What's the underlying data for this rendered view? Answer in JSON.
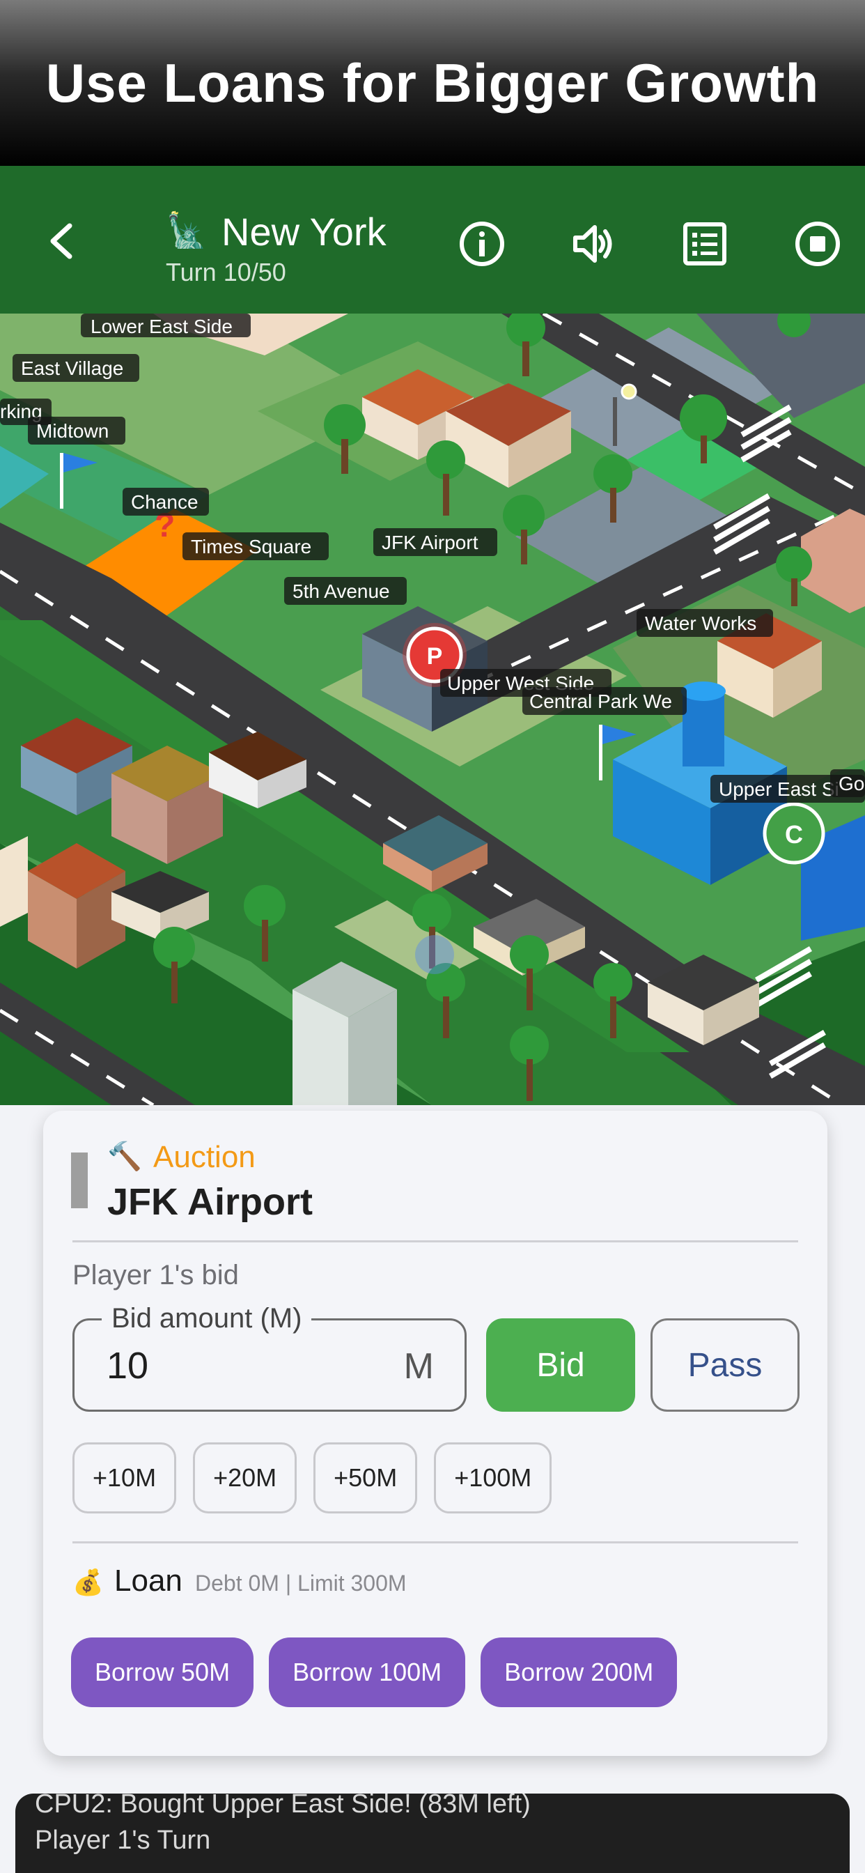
{
  "banner": {
    "title": "Use Loans for Bigger Growth"
  },
  "header": {
    "city_icon": "statue-of-liberty-icon",
    "city_name": "New York",
    "turn": "Turn 10/50",
    "buttons": [
      "back-icon",
      "info-icon",
      "volume-icon",
      "list-icon",
      "stop-icon"
    ]
  },
  "map": {
    "labels": {
      "lower_east_side": "Lower East Side",
      "east_village": "East Village",
      "parking": "rking",
      "midtown": "Midtown",
      "chance": "Chance",
      "times_square": "Times Square",
      "jfk_airport": "JFK Airport",
      "fifth_avenue": "5th Avenue",
      "water_works": "Water Works",
      "upper_west_side": "Upper West Side",
      "central_park_west": "Central Park We",
      "upper_east_side": "Upper East Si",
      "go": "Go"
    },
    "chance_mark": "?",
    "player_token": "P",
    "cpu_token": "C",
    "colors": {
      "grass": "#3f9b45",
      "road": "#3b3b3d",
      "orange_tile": "#ff8c00",
      "player": "#e53935",
      "cpu": "#43a047"
    }
  },
  "auction": {
    "icon": "hammer-icon",
    "label": "Auction",
    "property": "JFK Airport",
    "bid_caption": "Player 1's bid",
    "bid_legend": "Bid amount (M)",
    "bid_value": "10",
    "bid_unit": "M",
    "bid_button": "Bid",
    "pass_button": "Pass",
    "increments": [
      "+10M",
      "+20M",
      "+50M",
      "+100M"
    ]
  },
  "loan": {
    "icon": "money-bag-icon",
    "label": "Loan",
    "info": "Debt 0M | Limit 300M",
    "buttons": [
      "Borrow 50M",
      "Borrow 100M",
      "Borrow 200M"
    ]
  },
  "log": {
    "lines": [
      "CPU2: Bought Upper East Side! (83M left)",
      "Player 1's Turn"
    ]
  }
}
